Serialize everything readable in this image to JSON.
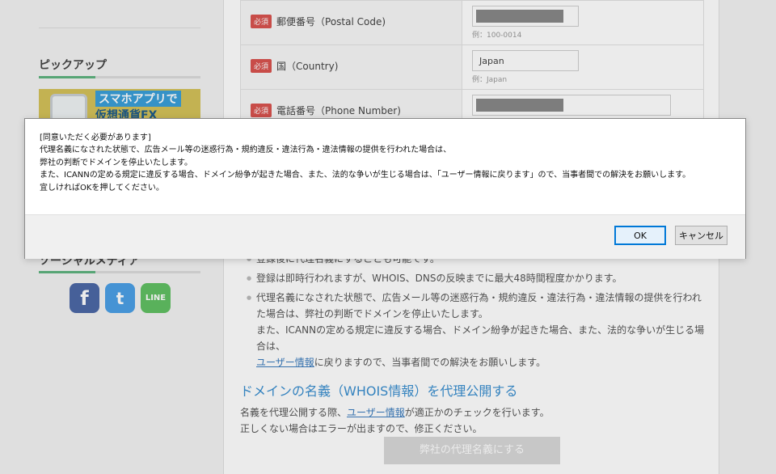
{
  "sidebar": {
    "pickup_heading": "ピックアップ",
    "banner": {
      "line1": "スマホアプリで",
      "line2": "仮想通貨FX"
    },
    "social_heading": "ソーシャルメディア",
    "social": {
      "facebook": "f",
      "twitter": "t",
      "line": "LINE"
    }
  },
  "form": {
    "rows": [
      {
        "required": "必須",
        "label": "郵便番号（Postal Code)",
        "value": "",
        "hint": "例：100-0014",
        "masked": true
      },
      {
        "required": "必須",
        "label": "国（Country)",
        "value": "Japan",
        "hint": "例：Japan",
        "masked": false
      },
      {
        "required": "必須",
        "label": "電話番号（Phone Number)",
        "value": "",
        "hint": "",
        "masked": true
      }
    ]
  },
  "notes": {
    "item1": "登録後に代理名義にすることも可能です。",
    "item2": "登録は即時行われますが、WHOIS、DNSの反映までに最大48時間程度かかります。",
    "item3_a": "代理名義になされた状態で、広告メール等の迷惑行為・規約違反・違法行為・違法情報の提供を行われた場合は、弊社の判断でドメインを停止いたします。",
    "item3_b": "また、ICANNの定める規定に違反する場合、ドメイン紛争が起きた場合、また、法的な争いが生じる場合は、",
    "item3_link": "ユーザー情報",
    "item3_c": "に戻りますので、当事者間での解決をお願いします。"
  },
  "section": {
    "title": "ドメインの名義（WHOIS情報）を代理公開する",
    "desc_a": "名義を代理公開する際、",
    "desc_link": "ユーザー情報",
    "desc_b": "が適正かのチェックを行います。",
    "desc_line2": "正しくない場合はエラーが出ますので、修正ください。",
    "button": "弊社の代理名義にする"
  },
  "dialog": {
    "lines": [
      "[同意いただく必要があります]",
      "代理名義になされた状態で、広告メール等の迷惑行為・規約違反・違法行為・違法情報の提供を行われた場合は、",
      "弊社の判断でドメインを停止いたします。",
      "また、ICANNの定める規定に違反する場合、ドメイン紛争が起きた場合、また、法的な争いが生じる場合は、「ユーザー情報に戻ります」ので、当事者間での解決をお願いします。",
      "宜しければOKを押してください。"
    ],
    "ok_label": "OK",
    "cancel_label": "キャンセル"
  }
}
